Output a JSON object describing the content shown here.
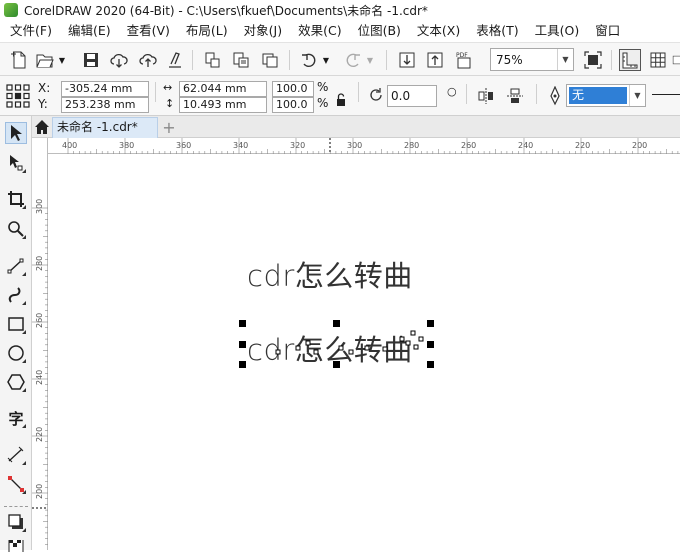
{
  "window": {
    "title": "CorelDRAW 2020 (64-Bit) - C:\\Users\\fkuef\\Documents\\未命名 -1.cdr*"
  },
  "menu": [
    "文件(F)",
    "编辑(E)",
    "查看(V)",
    "布局(L)",
    "对象(J)",
    "效果(C)",
    "位图(B)",
    "文本(X)",
    "表格(T)",
    "工具(O)",
    "窗口"
  ],
  "toolbar": {
    "zoom": "75%"
  },
  "property_bar": {
    "x_label": "X:",
    "x_value": "-305.24 mm",
    "y_label": "Y:",
    "y_value": "253.238 mm",
    "width_value": "62.044 mm",
    "height_value": "10.493 mm",
    "scale_w": "100.0",
    "scale_h": "100.0",
    "percent": "%",
    "rotation_value": "0.0",
    "outline_value": "无"
  },
  "document": {
    "tab_label": "未命名 -1.cdr*"
  },
  "ruler": {
    "h_labels": [
      "400",
      "380",
      "360",
      "340",
      "320",
      "300",
      "280",
      "260",
      "240",
      "220",
      "200"
    ],
    "v_labels": [
      "300",
      "280",
      "260",
      "240",
      "220",
      "200"
    ]
  },
  "canvas": {
    "text_top": "cdr怎么转曲",
    "text_bottom": "cdr怎么转曲"
  },
  "colors": {
    "accent": "#dce9f7",
    "selection": "#000000"
  }
}
